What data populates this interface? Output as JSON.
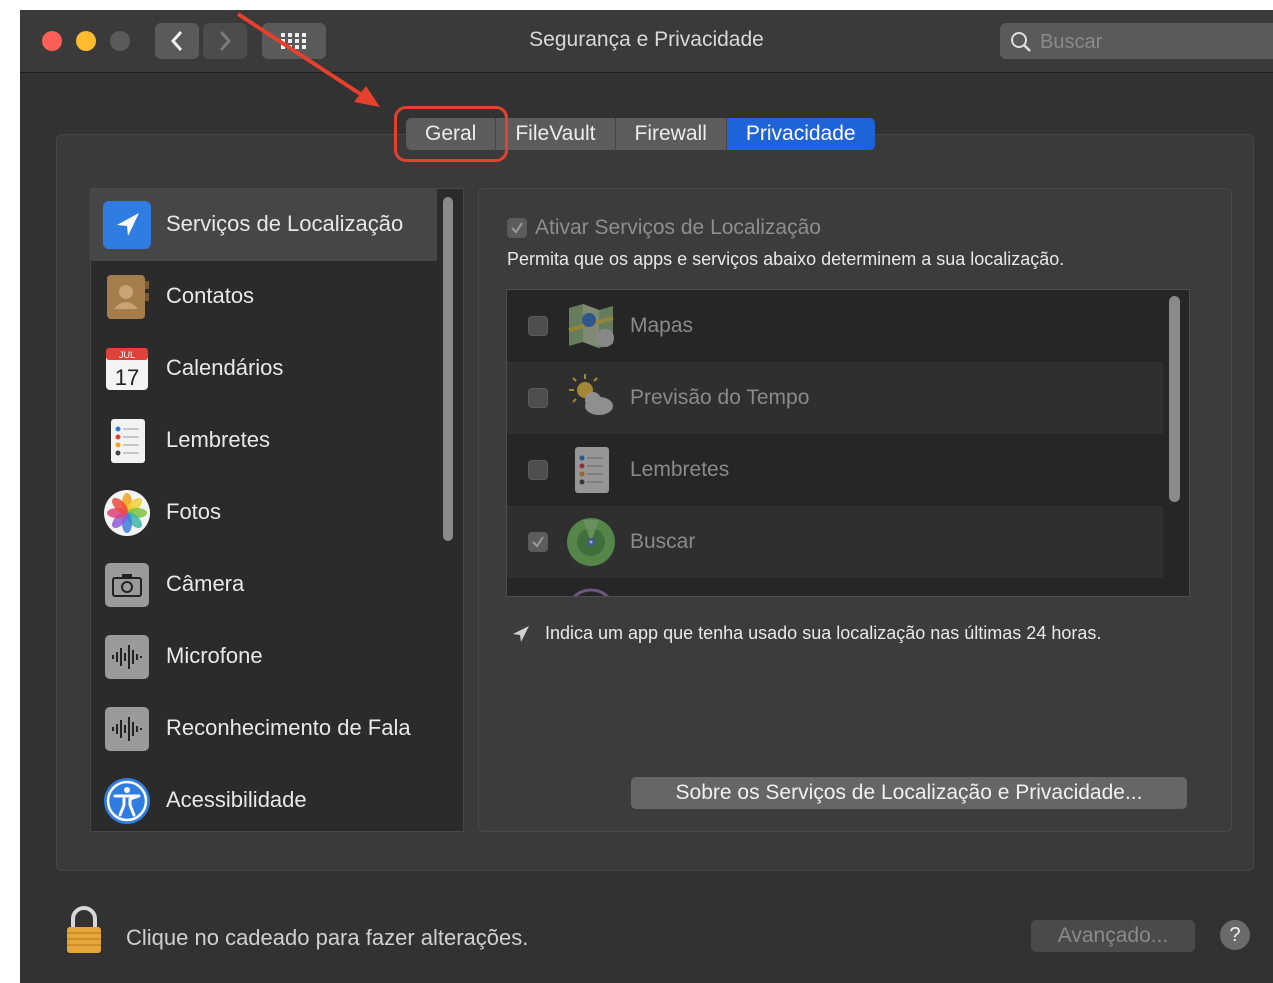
{
  "window": {
    "title": "Segurança e Privacidade",
    "search_placeholder": "Buscar"
  },
  "tabs": [
    {
      "label": "Geral",
      "active": false
    },
    {
      "label": "FileVault",
      "active": false
    },
    {
      "label": "Firewall",
      "active": false
    },
    {
      "label": "Privacidade",
      "active": true
    }
  ],
  "sidebar": {
    "items": [
      {
        "label": "Serviços de Localização",
        "icon": "location-arrow-icon",
        "selected": true
      },
      {
        "label": "Contatos",
        "icon": "contacts-icon",
        "selected": false
      },
      {
        "label": "Calendários",
        "icon": "calendar-icon",
        "selected": false,
        "calendar_month": "JUL",
        "calendar_day": "17"
      },
      {
        "label": "Lembretes",
        "icon": "reminders-icon",
        "selected": false
      },
      {
        "label": "Fotos",
        "icon": "photos-icon",
        "selected": false
      },
      {
        "label": "Câmera",
        "icon": "camera-icon",
        "selected": false
      },
      {
        "label": "Microfone",
        "icon": "microphone-icon",
        "selected": false
      },
      {
        "label": "Reconhecimento de Fala",
        "icon": "speech-recognition-icon",
        "selected": false
      },
      {
        "label": "Acessibilidade",
        "icon": "accessibility-icon",
        "selected": false
      }
    ]
  },
  "location": {
    "enable_label": "Ativar Serviços de Localização",
    "enable_checked": true,
    "description": "Permita que os apps e serviços abaixo determinem a sua localização.",
    "apps": [
      {
        "label": "Mapas",
        "icon": "maps-icon",
        "checked": false
      },
      {
        "label": "Previsão do Tempo",
        "icon": "weather-icon",
        "checked": false
      },
      {
        "label": "Lembretes",
        "icon": "reminders-icon",
        "checked": false
      },
      {
        "label": "Buscar",
        "icon": "find-my-icon",
        "checked": true
      }
    ],
    "note": "Indica um app que tenha usado sua localização nas últimas 24 horas.",
    "about_button": "Sobre os Serviços de Localização e Privacidade..."
  },
  "footer": {
    "lock_text": "Clique no cadeado para fazer alterações.",
    "advanced_button": "Avançado...",
    "help_button": "?"
  },
  "colors": {
    "accent": "#1f63d8",
    "annotation": "#e5412e",
    "close": "#ff5f57",
    "minimize": "#febc2e",
    "zoom_disabled": "#5a5a5a"
  }
}
